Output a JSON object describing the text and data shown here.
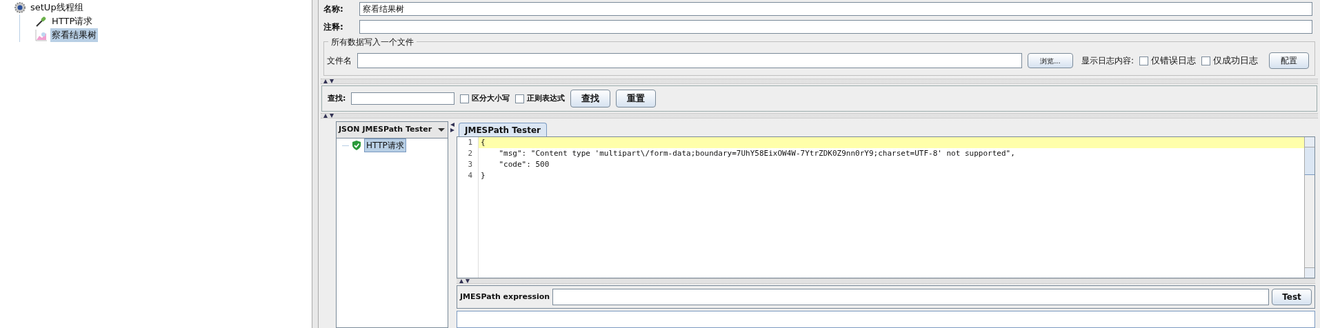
{
  "tree": [
    {
      "label": "setUp线程组",
      "kind": "gear",
      "selected": false,
      "children": [
        {
          "label": "HTTP请求",
          "kind": "dropper",
          "selected": false
        },
        {
          "label": "察看结果树",
          "kind": "graph",
          "selected": true
        }
      ]
    }
  ],
  "name_field": {
    "label": "名称:",
    "value": "察看结果树"
  },
  "comment_field": {
    "label": "注释:"
  },
  "file_group": {
    "title": "所有数据写入一个文件",
    "file_label": "文件名",
    "browse_button": "浏览...",
    "log_label": "显示日志内容:",
    "checkboxes": [
      {
        "label": "仅错误日志",
        "checked": false
      },
      {
        "label": "仅成功日志",
        "checked": false
      }
    ],
    "config_button": "配置"
  },
  "search": {
    "label": "查找:",
    "checkboxes": [
      {
        "label": "区分大小写",
        "checked": false
      },
      {
        "label": "正则表达式",
        "checked": false
      }
    ],
    "buttons": [
      "查找",
      "重置"
    ]
  },
  "renderer": {
    "value": "JSON JMESPath Tester"
  },
  "results": [
    {
      "label": "HTTP请求",
      "selected": true
    }
  ],
  "tabs": [
    {
      "label": "JMESPath Tester",
      "selected": true
    }
  ],
  "editor": {
    "lines": [
      {
        "number": "1",
        "text": "{",
        "highlighted": true
      },
      {
        "number": "2",
        "text": "    \"msg\": \"Content type 'multipart\\/form-data;boundary=7UhY58EixOW4W-7YtrZDK0Z9nn0rY9;charset=UTF-8' not supported\",",
        "highlighted": false
      },
      {
        "number": "3",
        "text": "    \"code\": 500",
        "highlighted": false
      },
      {
        "number": "4",
        "text": "}",
        "highlighted": false
      }
    ]
  },
  "expression": {
    "label": "JMESPath expression",
    "button": "Test"
  }
}
